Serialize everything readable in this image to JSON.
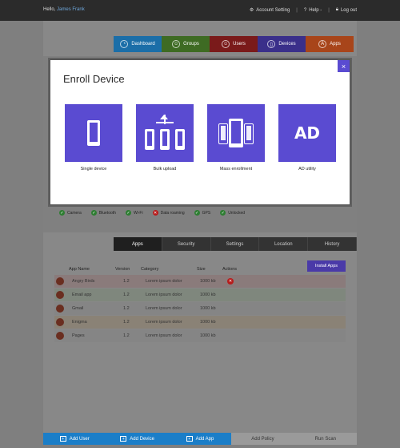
{
  "header": {
    "greeting": "Hello,",
    "user_name": "James Frank",
    "account_setting": "Account Setting",
    "help": "Help -",
    "logout": "Log out"
  },
  "nav": {
    "tabs": [
      {
        "label": "Dashboard",
        "color": "#1b6ea8"
      },
      {
        "label": "Groups",
        "color": "#3e6b23"
      },
      {
        "label": "Users",
        "color": "#7a1a1a"
      },
      {
        "label": "Devices",
        "color": "#3a2f8a"
      },
      {
        "label": "Apps",
        "color": "#a8451a"
      }
    ]
  },
  "features": [
    {
      "label": "Camera",
      "status": "ok"
    },
    {
      "label": "Bluetooth",
      "status": "ok"
    },
    {
      "label": "Wi-Fi",
      "status": "ok"
    },
    {
      "label": "Data roaming",
      "status": "blocked"
    },
    {
      "label": "GPS",
      "status": "ok"
    },
    {
      "label": "Unlocked",
      "status": "ok"
    }
  ],
  "subtabs": [
    "Apps",
    "Security",
    "Settings",
    "Location",
    "History"
  ],
  "apps": {
    "install_label": "Install Apps",
    "columns": [
      "App Name",
      "Version",
      "Category",
      "Size",
      "Actions"
    ],
    "rows": [
      {
        "name": "Angry Birds",
        "version": "1.2",
        "category": "Lorem ipsum dolor",
        "size": "1000 kb",
        "action": "remove",
        "tint": "#8a7b7b"
      },
      {
        "name": "Email app",
        "version": "1.2",
        "category": "Lorem ipsum dolor",
        "size": "1000 kb",
        "action": "",
        "tint": "#7f877d"
      },
      {
        "name": "Gmail",
        "version": "1.2",
        "category": "Lorem ipsum dolor",
        "size": "1000 kb",
        "action": "",
        "tint": "#858585"
      },
      {
        "name": "Enigma",
        "version": "1.2",
        "category": "Lorem ipsum dolor",
        "size": "1000 kb",
        "action": "",
        "tint": "#8a8276"
      },
      {
        "name": "Pages",
        "version": "1.2",
        "category": "Lorem ipsum dolor",
        "size": "1000 kb",
        "action": "",
        "tint": "#858585"
      }
    ]
  },
  "bottombar": {
    "add_user": "Add User",
    "add_device": "Add Device",
    "add_app": "Add App",
    "add_policy": "Add Policy",
    "run_scan": "Run Scan"
  },
  "modal": {
    "title": "Enroll Device",
    "close": "×",
    "options": [
      {
        "label": "Single device",
        "icon": "single-phone-icon"
      },
      {
        "label": "Bulk upload",
        "icon": "bulk-upload-icon"
      },
      {
        "label": "Mass enrollment",
        "icon": "mass-enrollment-icon"
      },
      {
        "label": "AD utility",
        "icon": "ad-icon",
        "glyph": "AD"
      }
    ],
    "accent": "#5a4bd1"
  }
}
